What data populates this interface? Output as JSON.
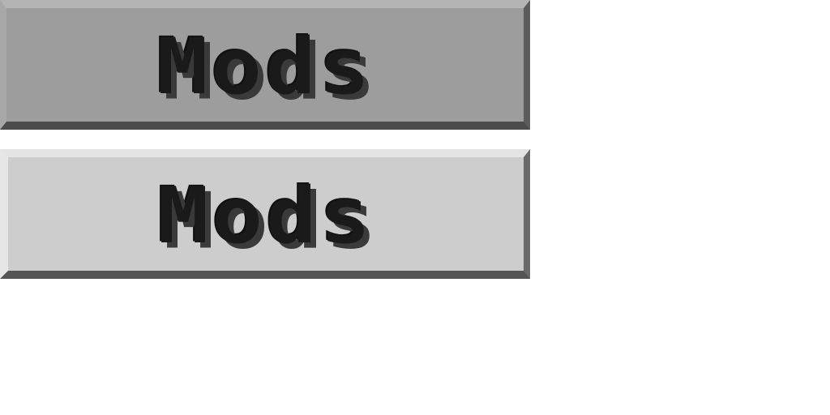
{
  "buttons": [
    {
      "state": "normal",
      "label": "Mods"
    },
    {
      "state": "hover",
      "label": "Mods"
    }
  ],
  "colors": {
    "normal_face": "#9d9d9d",
    "hover_face": "#cdcdcd",
    "label_text": "#1a1a1a",
    "label_shadow": "#3a3a3a",
    "background": "#ffffff"
  }
}
